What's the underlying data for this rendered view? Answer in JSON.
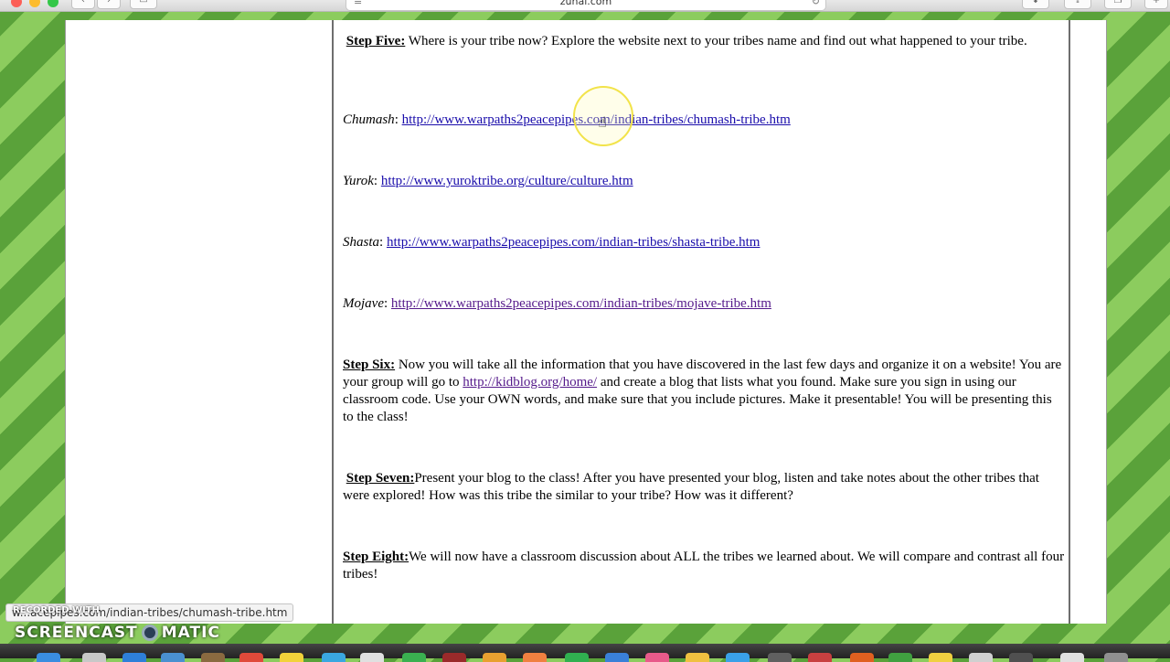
{
  "browser": {
    "address": "zunal.com"
  },
  "steps": {
    "five": {
      "label": "Step Five:",
      "text": " Where is your tribe now? Explore the website next to your tribes name and find out what happened to your tribe."
    },
    "six": {
      "label": "Step Six:",
      "text_before": " Now you will take all the information that you have discovered in the last few days and organize it on a website! You are your group will go to ",
      "link": "http://kidblog.org/home/",
      "text_after": " and create a blog that lists what you found. Make sure you sign in using our classroom code. Use your OWN words, and make sure that you include pictures. Make it presentable! You will be presenting this to the class!"
    },
    "seven": {
      "label": "Step Seven:",
      "text": "Present your blog to the class! After you have presented your blog, listen and take notes about the other tribes that were explored! How was this tribe the similar to your tribe? How was it different?"
    },
    "eight": {
      "label": "Step Eight:",
      "text": "We will now have a classroom discussion about ALL the tribes we learned about. We will compare and contrast all four tribes!"
    }
  },
  "tribes": [
    {
      "name": "Chumash",
      "url": "http://www.warpaths2peacepipes.com/indian-tribes/chumash-tribe.htm"
    },
    {
      "name": "Yurok",
      "url": "http://www.yuroktribe.org/culture/culture.htm"
    },
    {
      "name": "Shasta",
      "url": "http://www.warpaths2peacepipes.com/indian-tribes/shasta-tribe.htm"
    },
    {
      "name": "Mojave",
      "url": "http://www.warpaths2peacepipes.com/indian-tribes/mojave-tribe.htm"
    }
  ],
  "status_url": "w...acepipes.com/indian-tribes/chumash-tribe.htm",
  "overlay": {
    "recorded": "RECORDED WITH",
    "brand_left": "SCREENCAST",
    "brand_right": "MATIC"
  }
}
